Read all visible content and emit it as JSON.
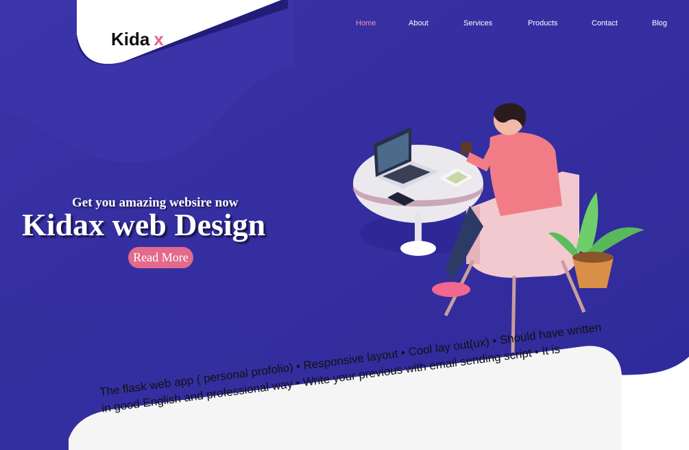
{
  "brand": {
    "name": "Kida",
    "mark": "x"
  },
  "nav": {
    "items": [
      {
        "label": "Home",
        "active": true
      },
      {
        "label": "About",
        "active": false
      },
      {
        "label": "Services",
        "active": false
      },
      {
        "label": "Products",
        "active": false
      },
      {
        "label": "Contact",
        "active": false
      },
      {
        "label": "Blog",
        "active": false
      }
    ]
  },
  "hero": {
    "tagline": "Get you amazing websire now",
    "headline": "Kidax web Design",
    "cta_label": "Read More"
  },
  "features": {
    "text": "The flask web app ( personal profolio) • Responsive layout • Cool lay out(ux) • Should have written in good English and professional way • Write your previous with email sending script • It is"
  },
  "colors": {
    "hero_bg": "#3a32a3",
    "accent": "#e36a8d",
    "nav_active": "#f08fb0",
    "card_bg": "#f5f5f5"
  }
}
